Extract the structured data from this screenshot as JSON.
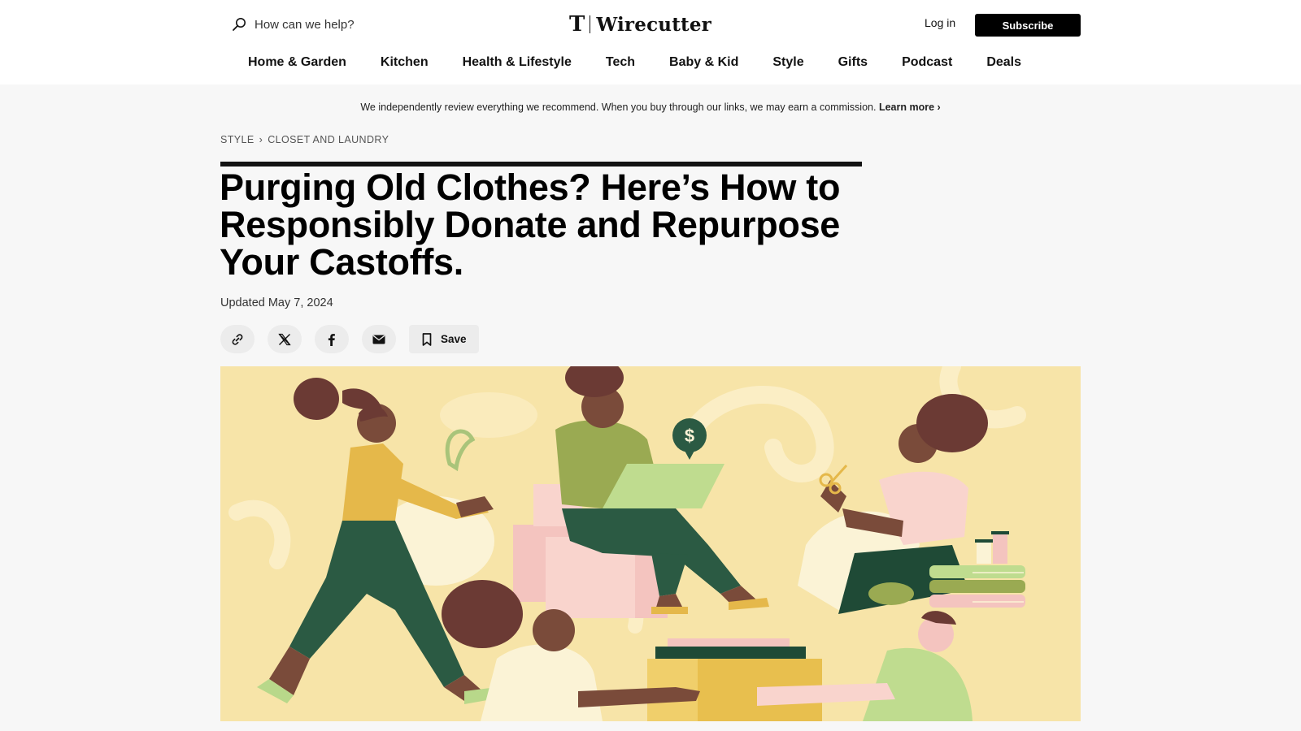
{
  "header": {
    "search_placeholder": "How can we help?",
    "logo_mark": "T",
    "logo_text": "Wirecutter",
    "login_label": "Log in",
    "subscribe_label": "Subscribe"
  },
  "nav": {
    "items": [
      "Home & Garden",
      "Kitchen",
      "Health & Lifestyle",
      "Tech",
      "Baby & Kid",
      "Style",
      "Gifts",
      "Podcast",
      "Deals"
    ]
  },
  "disclosure": {
    "text": "We independently review everything we recommend. When you buy through our links, we may earn a commission.",
    "link": "Learn more ›"
  },
  "breadcrumb": {
    "section": "STYLE",
    "separator": "›",
    "subsection": "CLOSET AND LAUNDRY"
  },
  "article": {
    "title": "Purging Old Clothes? Here’s How to Responsibly Donate and Repurpose Your Castoffs.",
    "updated": "Updated May 7, 2024",
    "save_label": "Save",
    "hero_badge": "$"
  },
  "icons": {
    "search": "search-icon",
    "link": "link-icon",
    "x": "x-logo-icon",
    "facebook": "facebook-icon",
    "email": "email-icon",
    "bookmark": "bookmark-icon"
  },
  "colors": {
    "hero_background": "#f7e4a8",
    "subscribe_bg": "#000000",
    "page_bg": "#f7f7f7"
  }
}
